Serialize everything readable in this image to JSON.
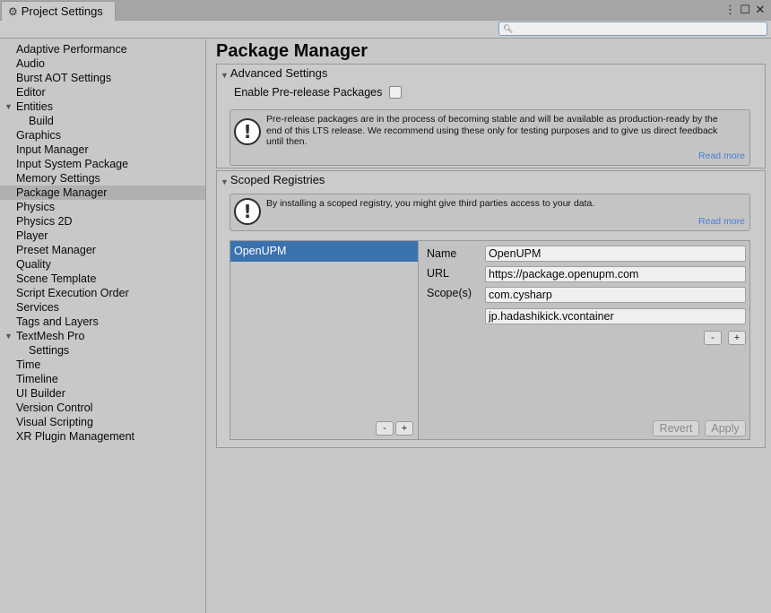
{
  "window": {
    "tab_title": "Project Settings",
    "controls": [
      "⋮",
      "☐",
      "✕"
    ]
  },
  "search": {
    "placeholder": "",
    "value": ""
  },
  "sidebar": {
    "items": [
      {
        "label": "Adaptive Performance"
      },
      {
        "label": "Audio"
      },
      {
        "label": "Burst AOT Settings"
      },
      {
        "label": "Editor"
      },
      {
        "label": "Entities",
        "expanded": true
      },
      {
        "label": "Build",
        "child": true
      },
      {
        "label": "Graphics"
      },
      {
        "label": "Input Manager"
      },
      {
        "label": "Input System Package"
      },
      {
        "label": "Memory Settings"
      },
      {
        "label": "Package Manager",
        "selected": true
      },
      {
        "label": "Physics"
      },
      {
        "label": "Physics 2D"
      },
      {
        "label": "Player"
      },
      {
        "label": "Preset Manager"
      },
      {
        "label": "Quality"
      },
      {
        "label": "Scene Template"
      },
      {
        "label": "Script Execution Order"
      },
      {
        "label": "Services"
      },
      {
        "label": "Tags and Layers"
      },
      {
        "label": "TextMesh Pro",
        "expanded": true
      },
      {
        "label": "Settings",
        "child": true
      },
      {
        "label": "Time"
      },
      {
        "label": "Timeline"
      },
      {
        "label": "UI Builder"
      },
      {
        "label": "Version Control"
      },
      {
        "label": "Visual Scripting"
      },
      {
        "label": "XR Plugin Management"
      }
    ]
  },
  "main": {
    "title": "Package Manager",
    "advanced": {
      "header": "Advanced Settings",
      "prerelease_label": "Enable Pre-release Packages",
      "prerelease_checked": false,
      "help_text": "Pre-release packages are in the process of becoming stable and will be available as production-ready by the end of this LTS release. We recommend using these only for testing purposes and to give us direct feedback until then.",
      "read_more": "Read more"
    },
    "scoped": {
      "header": "Scoped Registries",
      "help_text": "By installing a scoped registry, you might give third parties access to your data.",
      "read_more": "Read more",
      "registries": [
        "OpenUPM"
      ],
      "list_remove": "-",
      "list_add": "+",
      "name_label": "Name",
      "name_value": "OpenUPM",
      "url_label": "URL",
      "url_value": "https://package.openupm.com",
      "scopes_label": "Scope(s)",
      "scopes": [
        "com.cysharp",
        "jp.hadashikick.vcontainer"
      ],
      "scope_remove": "-",
      "scope_add": "+",
      "revert": "Revert",
      "apply": "Apply"
    }
  },
  "colors": {
    "selection": "#3a72b0",
    "link": "#4e7cd6",
    "background": "#c8c8c8"
  }
}
